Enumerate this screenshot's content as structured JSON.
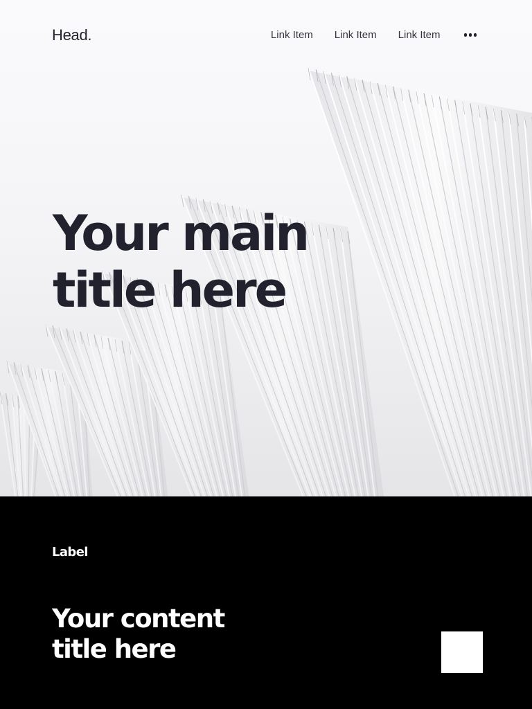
{
  "header": {
    "brand": "Head.",
    "nav_links": [
      "Link Item",
      "Link Item",
      "Link Item"
    ],
    "more_icon": "more-horizontal-icon"
  },
  "hero": {
    "title_line1": "Your main",
    "title_line2": "title here",
    "image": "white architectural fan-shaped structures"
  },
  "content_section": {
    "label": "Label",
    "title_line1": "Your content",
    "title_line2": "title here"
  },
  "colors": {
    "hero_background": "#f6f6f8",
    "text_dark": "#22222e",
    "section_background": "#000000",
    "text_light": "#ffffff"
  }
}
